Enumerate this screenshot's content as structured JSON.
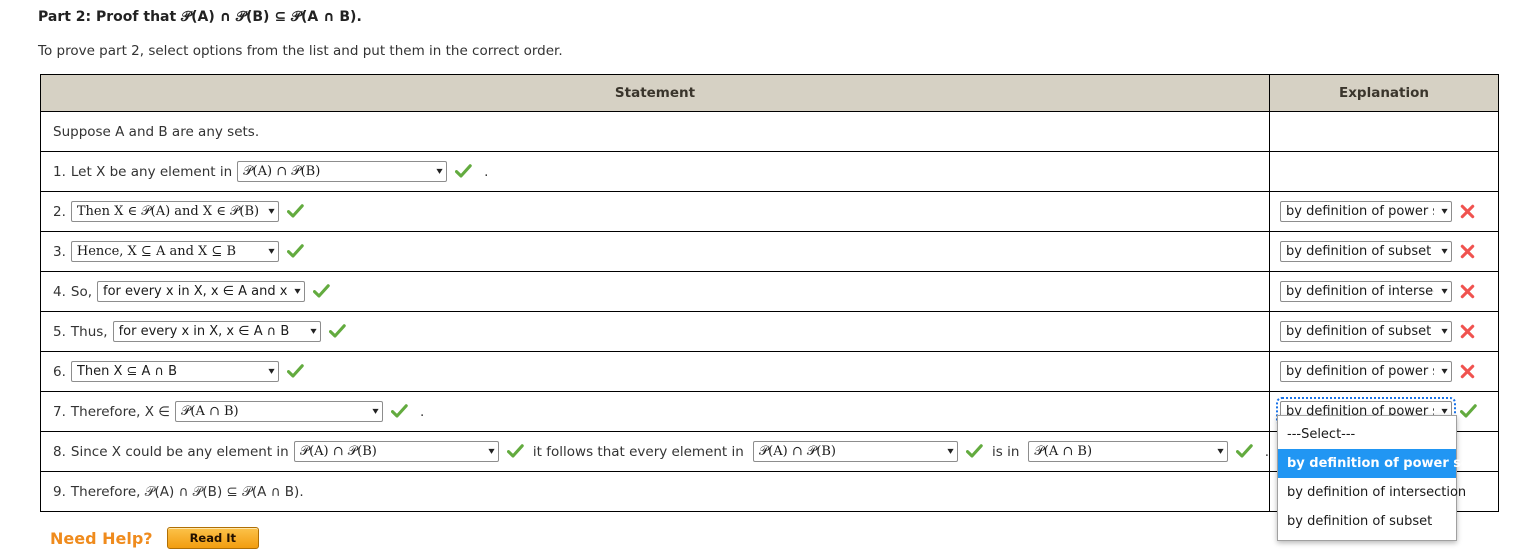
{
  "heading": {
    "prefix": "Part 2",
    "text": ": Proof that ",
    "formula": "ᵋb(A) ∩ ᵋb(B) ⊆ ᵋb(A ∩ B)."
  },
  "heading_full": "Part 2: Proof that 𝒫(A) ∩ 𝒫(B) ⊆ 𝒫(A ∩ B).",
  "instructions": "To prove part 2, select options from the list and put them in the correct order.",
  "table": {
    "columns": [
      "Statement",
      "Explanation"
    ],
    "rows": [
      {
        "id": "suppose",
        "statement_text": "Suppose A and B are any sets.",
        "explanation": null
      },
      {
        "id": "1",
        "number": "1.",
        "lead": "Let X be any element in",
        "select_value": "𝒫(A) ∩ 𝒫(B)",
        "select_status": "correct",
        "trailer": ".",
        "explanation": null
      },
      {
        "id": "2",
        "number": "2.",
        "lead": "",
        "select_value": "Then X ∈ 𝒫(A) and X ∈ 𝒫(B)",
        "select_status": "correct",
        "explanation_value": "by definition of power set",
        "explanation_status": "incorrect"
      },
      {
        "id": "3",
        "number": "3.",
        "lead": "",
        "select_value": "Hence, X ⊆ A and X ⊆ B",
        "select_status": "correct",
        "explanation_value": "by definition of subset",
        "explanation_status": "incorrect"
      },
      {
        "id": "4",
        "number": "4.",
        "lead": "So,",
        "select_value": "for every x in X, x ∈ A and x ∈ B",
        "select_status": "correct",
        "explanation_value": "by definition of intersection",
        "explanation_status": "incorrect"
      },
      {
        "id": "5",
        "number": "5.",
        "lead": "Thus,",
        "select_value": "for every x in X, x ∈ A ∩ B",
        "select_status": "correct",
        "explanation_value": "by definition of subset",
        "explanation_status": "incorrect"
      },
      {
        "id": "6",
        "number": "6.",
        "lead": "",
        "select_value": "Then X ⊆ A ∩ B",
        "select_status": "correct",
        "explanation_value": "by definition of power set",
        "explanation_status": "incorrect"
      },
      {
        "id": "7",
        "number": "7.",
        "lead": "Therefore, X ∈",
        "select_value": "𝒫(A ∩ B)",
        "select_status": "correct",
        "trailer": ".",
        "explanation_value": "by definition of power set",
        "explanation_status": "correct",
        "explanation_focused": true,
        "explanation_open": true
      },
      {
        "id": "8",
        "number": "8.",
        "lead": "Since X could be any element in",
        "select_value": "𝒫(A) ∩ 𝒫(B)",
        "select_status": "correct",
        "mid_text_1": "it follows that every element in",
        "select_value_2": "𝒫(A) ∩ 𝒫(B)",
        "select_status_2": "correct",
        "mid_text_2": "is in",
        "select_value_3": "𝒫(A ∩ B)",
        "select_status_3": "correct",
        "trailer": ".",
        "explanation": null
      },
      {
        "id": "9",
        "number": "9.",
        "statement_text": "Therefore, 𝒫(A) ∩ 𝒫(B) ⊆ 𝒫(A ∩ B).",
        "explanation": null
      }
    ]
  },
  "dropdown_popup": {
    "options": [
      "---Select---",
      "by definition of power set",
      "by definition of intersection",
      "by definition of subset"
    ],
    "selected_index": 1
  },
  "need_help": {
    "label": "Need Help?",
    "button": "Read It"
  },
  "colors": {
    "header_bg": "#d6d1c4",
    "border": "#000000",
    "correct": "#55a630",
    "incorrect": "#f25c54",
    "highlight": "#2196f3",
    "focus_ring": "#1a73e8",
    "need_help_orange": "#ef8b1d"
  }
}
